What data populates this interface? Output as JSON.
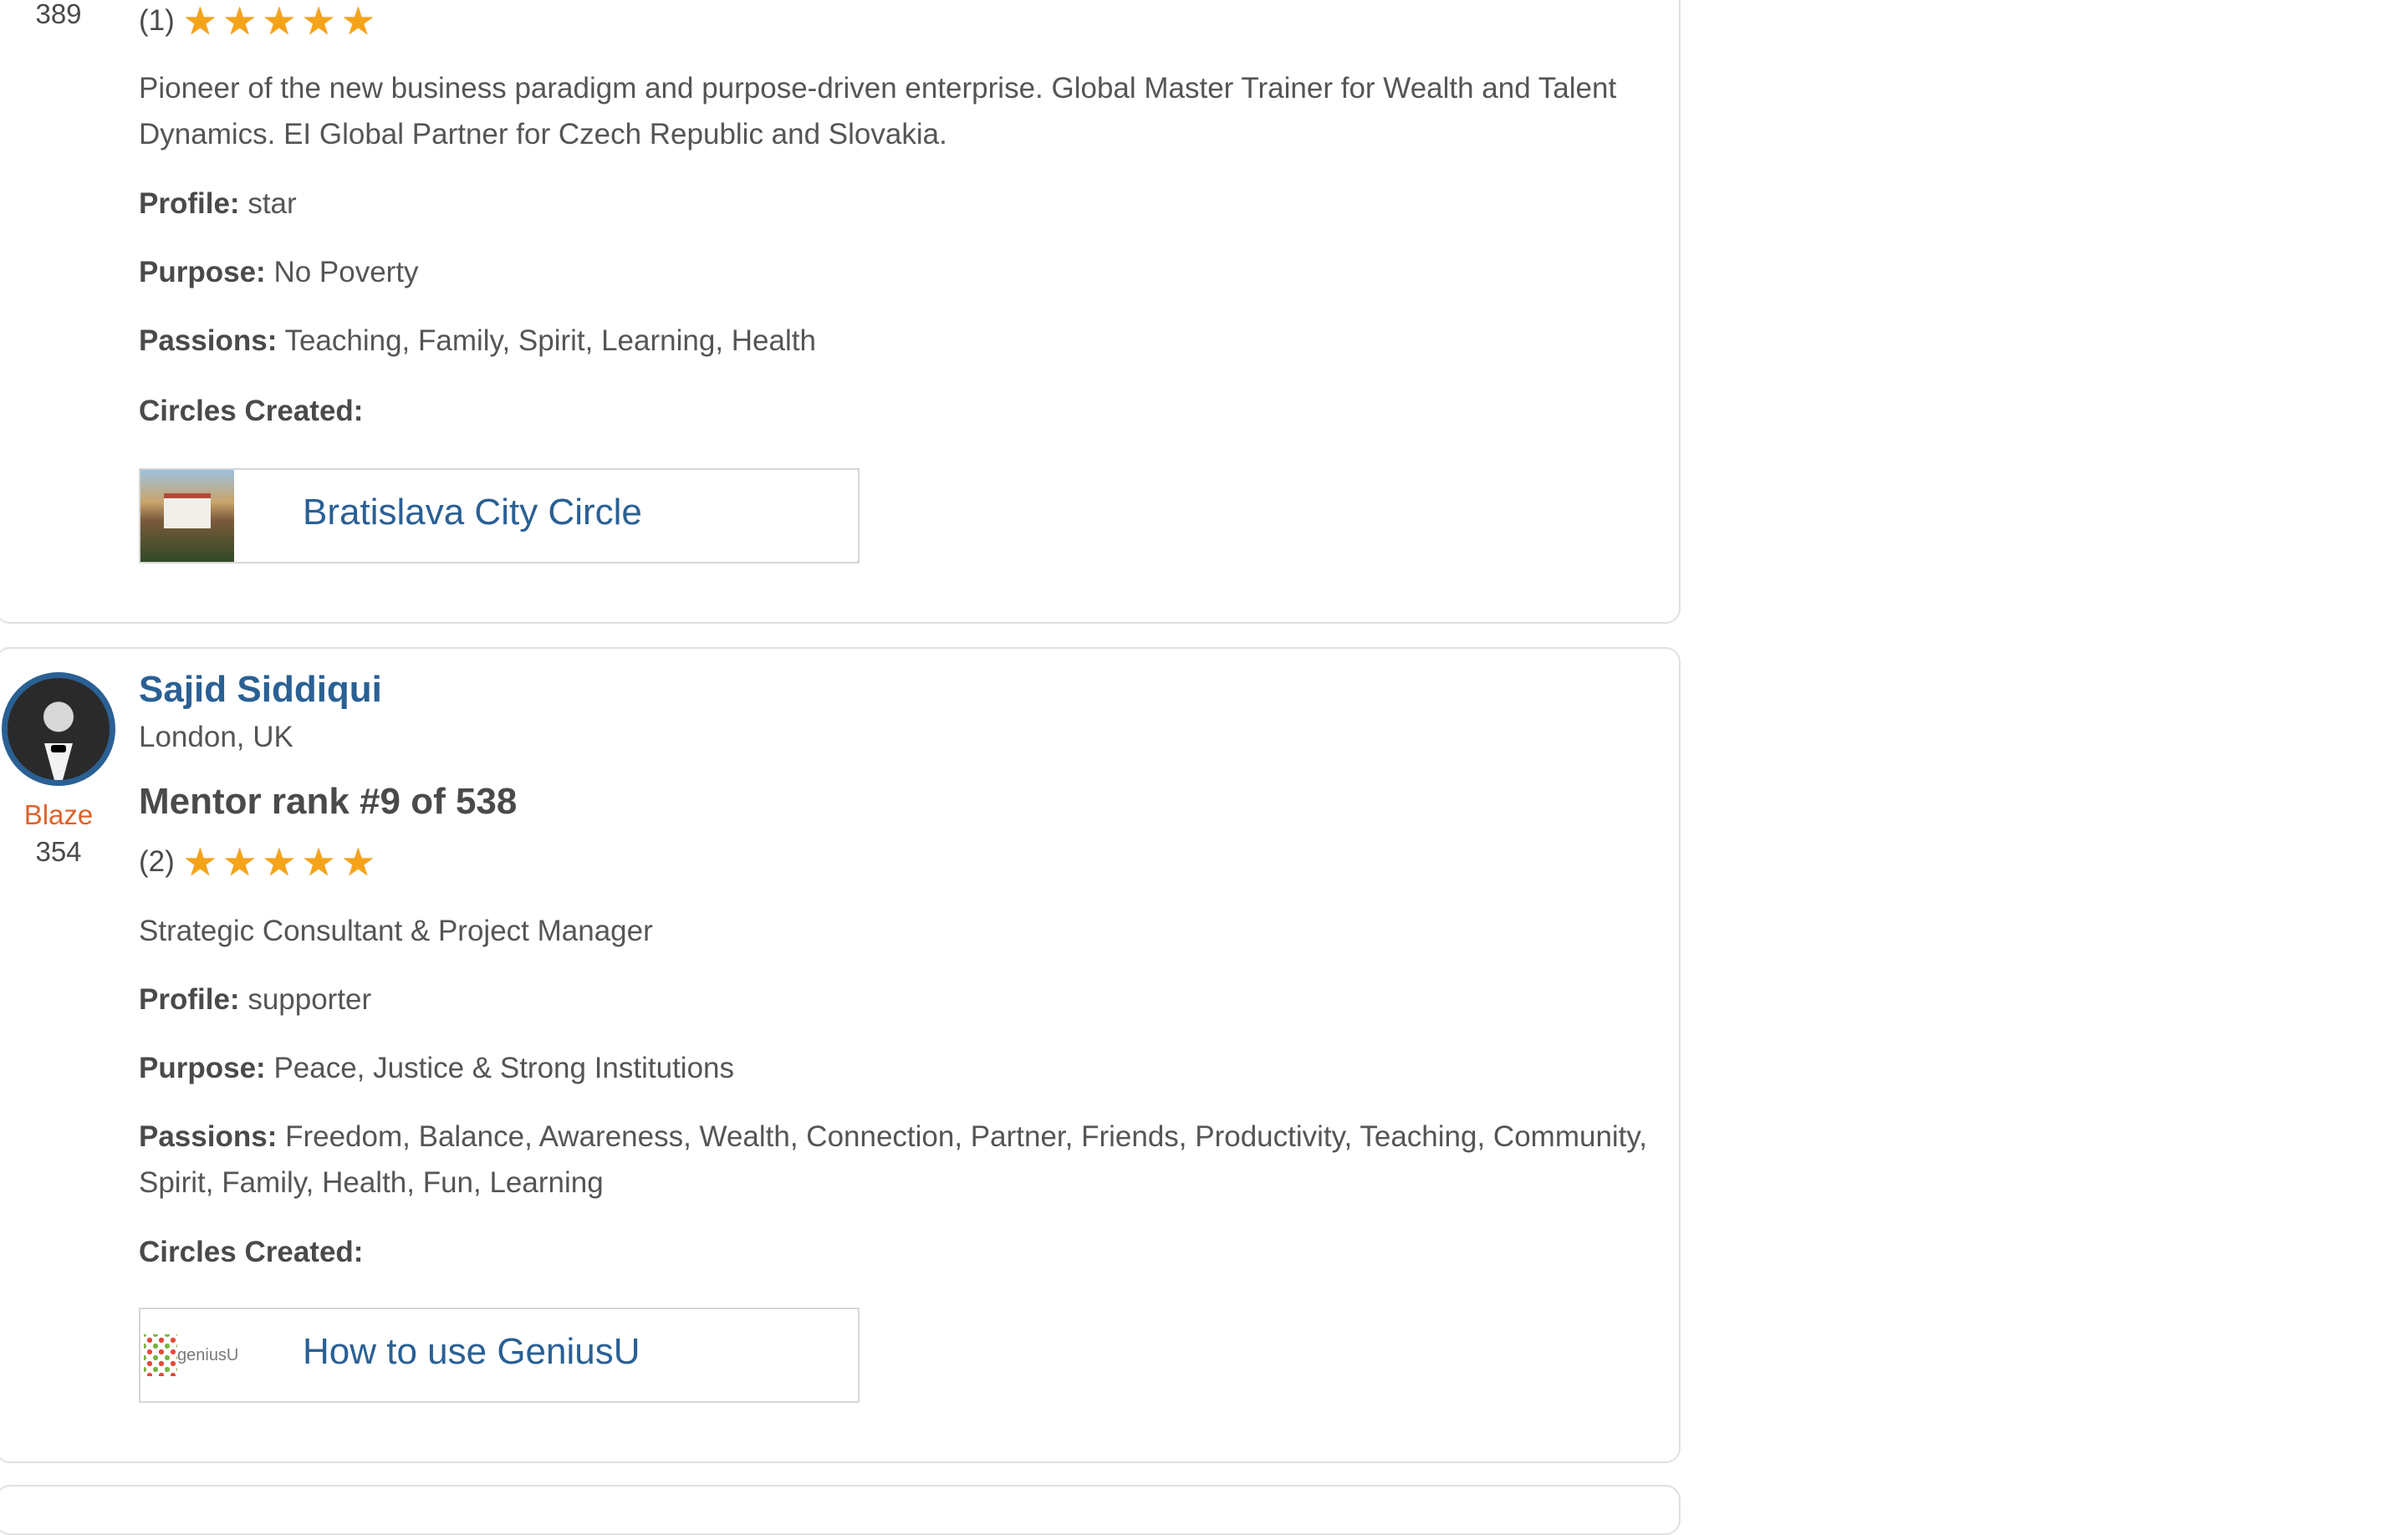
{
  "mentors": [
    {
      "score": "389",
      "rating_count": "(1)",
      "stars": 5,
      "bio": "Pioneer of the new business paradigm and purpose-driven enterprise. Global Master Trainer for Wealth and Talent Dynamics. EI Global Partner for Czech Republic and Slovakia.",
      "profile_label": "Profile:",
      "profile": "star",
      "purpose_label": "Purpose:",
      "purpose": "No Poverty",
      "passions_label": "Passions:",
      "passions": "Teaching, Family, Spirit, Learning, Health",
      "circles_label": "Circles Created:",
      "circle": "Bratislava City Circle"
    },
    {
      "name": "Sajid Siddiqui",
      "location": "London, UK",
      "level": "Blaze",
      "score": "354",
      "rank": "Mentor rank #9 of 538",
      "rating_count": "(2)",
      "stars": 5,
      "bio": "Strategic Consultant & Project Manager",
      "profile_label": "Profile:",
      "profile": "supporter",
      "purpose_label": "Purpose:",
      "purpose": "Peace, Justice & Strong Institutions",
      "passions_label": "Passions:",
      "passions": "Freedom, Balance, Awareness, Wealth, Connection, Partner, Friends, Productivity, Teaching, Community, Spirit, Family, Health, Fun, Learning",
      "circles_label": "Circles Created:",
      "circle": "How to use GeniusU",
      "circle_logo_text": "geniusU"
    }
  ],
  "colors": {
    "link": "#2a6094",
    "level": "#e0622a",
    "star": "#f5a319"
  }
}
